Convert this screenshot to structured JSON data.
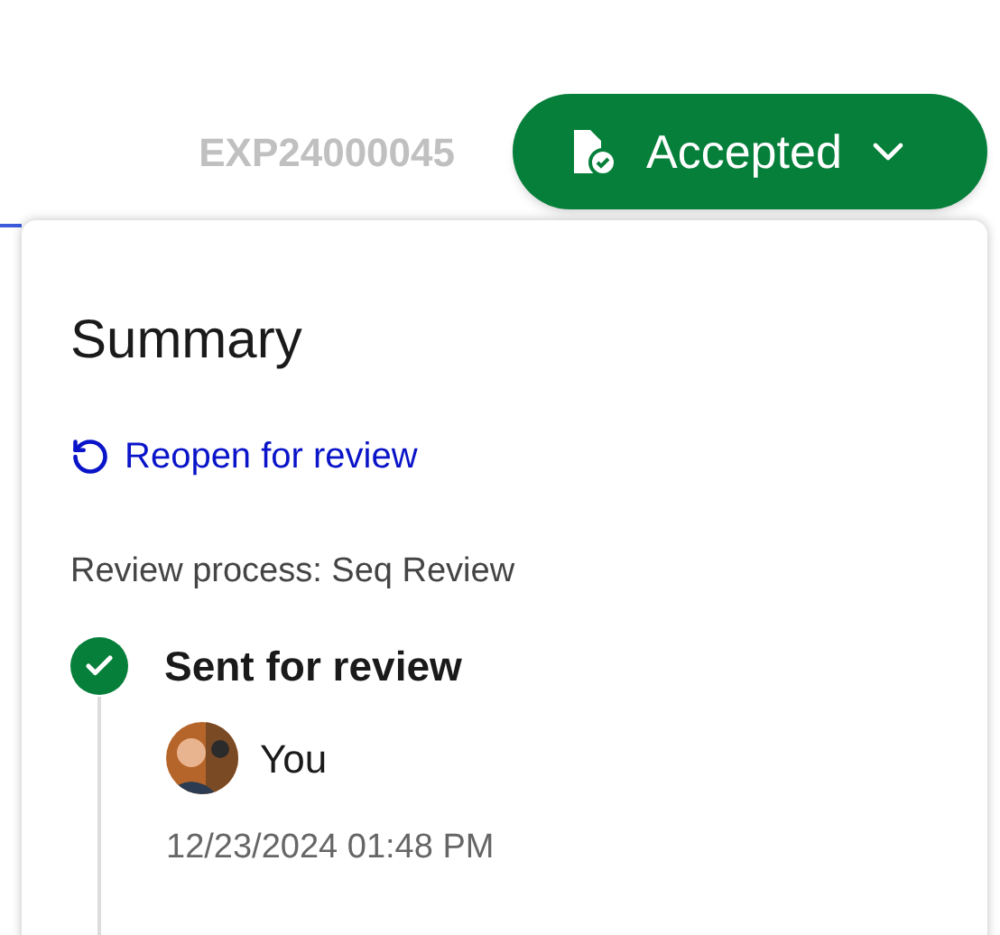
{
  "header": {
    "document_id": "EXP24000045",
    "status_button": {
      "label": "Accepted",
      "expanded": true
    }
  },
  "summary": {
    "title": "Summary",
    "reopen_link": "Reopen for review",
    "review_process": "Review process: Seq Review",
    "steps": [
      {
        "title": "Sent for review",
        "completed": true,
        "person": "You",
        "timestamp": "12/23/2024 01:48 PM"
      }
    ]
  }
}
